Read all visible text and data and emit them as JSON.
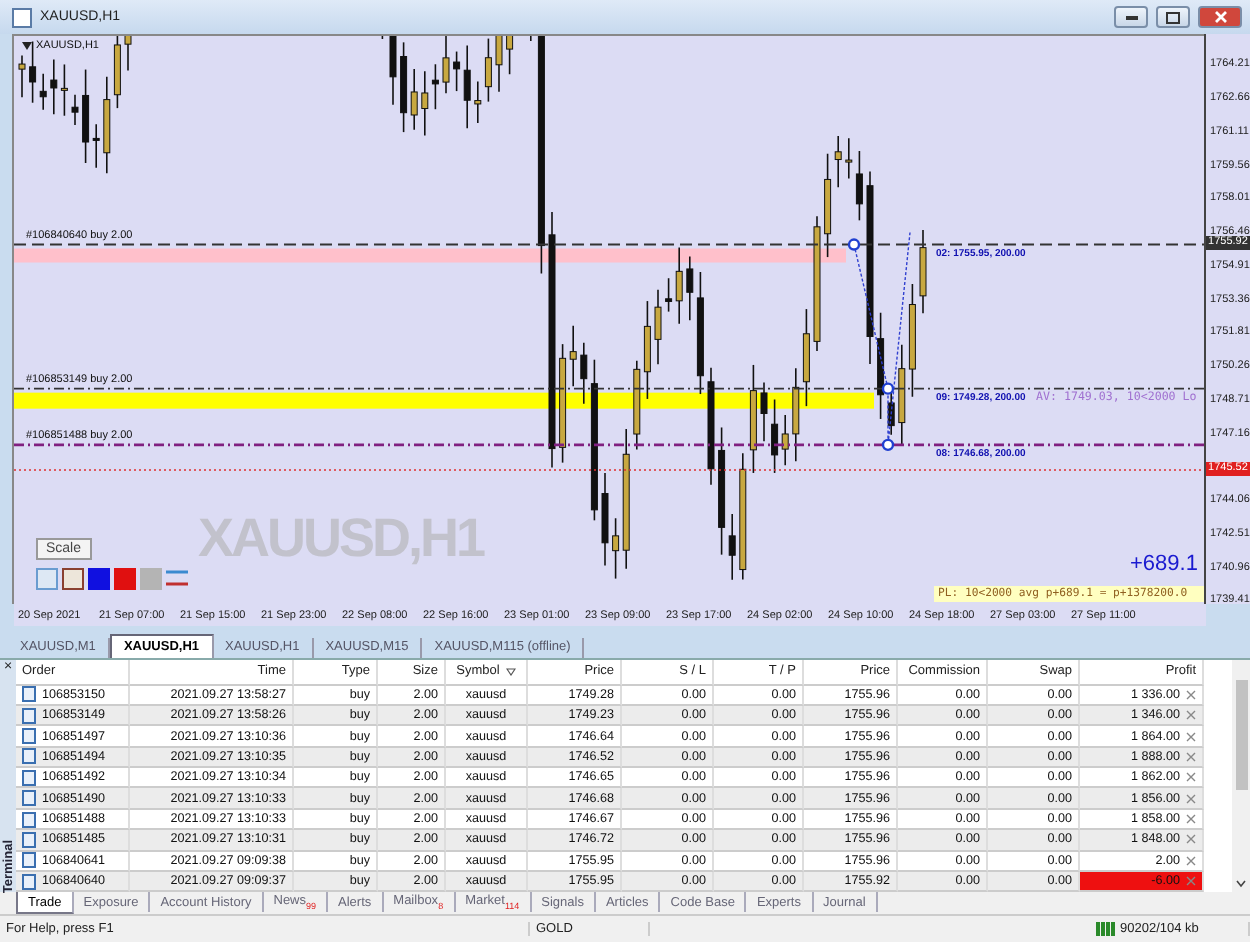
{
  "window": {
    "title": "XAUUSD,H1"
  },
  "chart": {
    "symbol_label": "XAUUSD,H1",
    "big_label": "XAUUSD,H1",
    "price_axis": [
      "1764.21",
      "1762.66",
      "1761.11",
      "1759.56",
      "1758.01",
      "1756.46",
      "1754.91",
      "1753.36",
      "1751.81",
      "1750.26",
      "1748.71",
      "1747.16",
      "1744.06",
      "1742.51",
      "1740.96",
      "1739.41"
    ],
    "current_price": "1755.92",
    "bid_price": "1745.52",
    "time_axis": [
      "20 Sep 2021",
      "21 Sep 07:00",
      "21 Sep 15:00",
      "21 Sep 23:00",
      "22 Sep 08:00",
      "22 Sep 16:00",
      "23 Sep 01:00",
      "23 Sep 09:00",
      "23 Sep 17:00",
      "24 Sep 02:00",
      "24 Sep 10:00",
      "24 Sep 18:00",
      "27 Sep 03:00",
      "27 Sep 11:00"
    ],
    "order_lines": [
      {
        "kind": "dashed",
        "label": "#106840640 buy 2.00",
        "info": "02: 1755.95, 200.00",
        "color": "#ffc0cb"
      },
      {
        "kind": "dashdot",
        "label": "#106853149 buy 2.00",
        "info": "09: 1749.28, 200.00",
        "color": "#ffff00"
      },
      {
        "kind": "dashdot",
        "label": "#106851488 buy 2.00",
        "info": "08: 1746.68, 200.00"
      }
    ],
    "average_label": "AV: 1749.03, 10<2000 Lo",
    "scale_button": "Scale",
    "profit_value": "+689.1",
    "summary": "PL: 10<2000 avg p+689.1 = p+1378200.0"
  },
  "chart_tabs": [
    {
      "label": "XAUUSD,M1",
      "selected": false
    },
    {
      "label": "XAUUSD,H1",
      "selected": true
    },
    {
      "label": "XAUUSD,H1",
      "selected": false
    },
    {
      "label": "XAUUSD,M15",
      "selected": false
    },
    {
      "label": "XAUUSD,M115 (offline)",
      "selected": false
    }
  ],
  "terminal": {
    "title": "Terminal",
    "close": "×",
    "columns": [
      "Order",
      "Time",
      "Type",
      "Size",
      "Symbol",
      "Price",
      "S / L",
      "T / P",
      "Price",
      "Commission",
      "Swap",
      "Profit"
    ],
    "rows": [
      {
        "order": "106853150",
        "time": "2021.09.27 13:58:27",
        "type": "buy",
        "size": "2.00",
        "symbol": "xauusd",
        "price": "1749.28",
        "sl": "0.00",
        "tp": "0.00",
        "current": "1755.96",
        "commission": "0.00",
        "swap": "0.00",
        "profit": "1 336.00",
        "loss": false
      },
      {
        "order": "106853149",
        "time": "2021.09.27 13:58:26",
        "type": "buy",
        "size": "2.00",
        "symbol": "xauusd",
        "price": "1749.23",
        "sl": "0.00",
        "tp": "0.00",
        "current": "1755.96",
        "commission": "0.00",
        "swap": "0.00",
        "profit": "1 346.00",
        "loss": false
      },
      {
        "order": "106851497",
        "time": "2021.09.27 13:10:36",
        "type": "buy",
        "size": "2.00",
        "symbol": "xauusd",
        "price": "1746.64",
        "sl": "0.00",
        "tp": "0.00",
        "current": "1755.96",
        "commission": "0.00",
        "swap": "0.00",
        "profit": "1 864.00",
        "loss": false
      },
      {
        "order": "106851494",
        "time": "2021.09.27 13:10:35",
        "type": "buy",
        "size": "2.00",
        "symbol": "xauusd",
        "price": "1746.52",
        "sl": "0.00",
        "tp": "0.00",
        "current": "1755.96",
        "commission": "0.00",
        "swap": "0.00",
        "profit": "1 888.00",
        "loss": false
      },
      {
        "order": "106851492",
        "time": "2021.09.27 13:10:34",
        "type": "buy",
        "size": "2.00",
        "symbol": "xauusd",
        "price": "1746.65",
        "sl": "0.00",
        "tp": "0.00",
        "current": "1755.96",
        "commission": "0.00",
        "swap": "0.00",
        "profit": "1 862.00",
        "loss": false
      },
      {
        "order": "106851490",
        "time": "2021.09.27 13:10:33",
        "type": "buy",
        "size": "2.00",
        "symbol": "xauusd",
        "price": "1746.68",
        "sl": "0.00",
        "tp": "0.00",
        "current": "1755.96",
        "commission": "0.00",
        "swap": "0.00",
        "profit": "1 856.00",
        "loss": false
      },
      {
        "order": "106851488",
        "time": "2021.09.27 13:10:33",
        "type": "buy",
        "size": "2.00",
        "symbol": "xauusd",
        "price": "1746.67",
        "sl": "0.00",
        "tp": "0.00",
        "current": "1755.96",
        "commission": "0.00",
        "swap": "0.00",
        "profit": "1 858.00",
        "loss": false
      },
      {
        "order": "106851485",
        "time": "2021.09.27 13:10:31",
        "type": "buy",
        "size": "2.00",
        "symbol": "xauusd",
        "price": "1746.72",
        "sl": "0.00",
        "tp": "0.00",
        "current": "1755.96",
        "commission": "0.00",
        "swap": "0.00",
        "profit": "1 848.00",
        "loss": false
      },
      {
        "order": "106840641",
        "time": "2021.09.27 09:09:38",
        "type": "buy",
        "size": "2.00",
        "symbol": "xauusd",
        "price": "1755.95",
        "sl": "0.00",
        "tp": "0.00",
        "current": "1755.96",
        "commission": "0.00",
        "swap": "0.00",
        "profit": "2.00",
        "loss": false
      },
      {
        "order": "106840640",
        "time": "2021.09.27 09:09:37",
        "type": "buy",
        "size": "2.00",
        "symbol": "xauusd",
        "price": "1755.95",
        "sl": "0.00",
        "tp": "0.00",
        "current": "1755.92",
        "commission": "0.00",
        "swap": "0.00",
        "profit": "-6.00",
        "loss": true
      }
    ]
  },
  "bottom_tabs": [
    {
      "label": "Trade",
      "selected": true
    },
    {
      "label": "Exposure",
      "selected": false
    },
    {
      "label": "Account History",
      "selected": false
    },
    {
      "label": "News",
      "badge": "99",
      "selected": false
    },
    {
      "label": "Alerts",
      "selected": false
    },
    {
      "label": "Mailbox",
      "badge": "8",
      "selected": false
    },
    {
      "label": "Market",
      "badge": "114",
      "selected": false
    },
    {
      "label": "Signals",
      "selected": false
    },
    {
      "label": "Articles",
      "selected": false
    },
    {
      "label": "Code Base",
      "selected": false
    },
    {
      "label": "Experts",
      "selected": false
    },
    {
      "label": "Journal",
      "selected": false
    }
  ],
  "status_bar": {
    "help": "For Help, press F1",
    "symbol": "GOLD",
    "memory": "90202/104 kb"
  }
}
